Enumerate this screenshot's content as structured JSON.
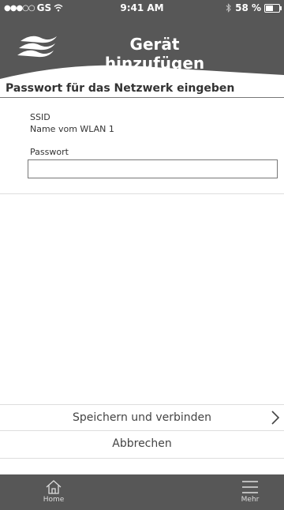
{
  "status_bar": {
    "carrier": "GS",
    "time": "9:41 AM",
    "battery": "58 %",
    "battery_level": 0.58
  },
  "header": {
    "title": "Gerät hinzufügen",
    "logo_icon": "wave-logo-icon"
  },
  "section": {
    "title": "Passwort für das Netzwerk eingeben"
  },
  "form": {
    "ssid_label": "SSID",
    "ssid_value": "Name vom WLAN 1",
    "password_label": "Passwort",
    "password_value": ""
  },
  "actions": {
    "save_label": "Speichern und verbinden",
    "cancel_label": "Abbrechen"
  },
  "tabbar": {
    "home_label": "Home",
    "more_label": "Mehr"
  },
  "colors": {
    "header_bg": "#575757",
    "tabbar_bg": "#575757"
  }
}
